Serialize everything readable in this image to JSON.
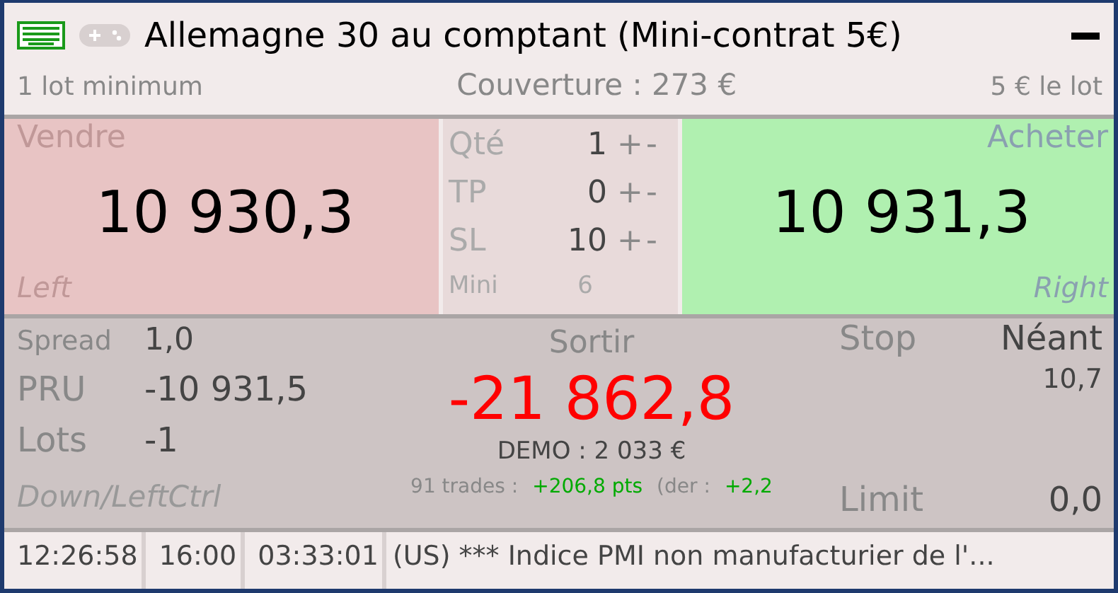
{
  "window": {
    "title": "Allemagne 30 au comptant (Mini-contrat 5€)"
  },
  "info_bar": {
    "minimum": "1 lot minimum",
    "coverage": "Couverture : 273 €",
    "lot_value": "5 € le lot"
  },
  "sell": {
    "label": "Vendre",
    "price": "10 930,3",
    "shortcut": "Left"
  },
  "order_params": [
    {
      "kind": "stepper",
      "label": "Qté",
      "value": "1",
      "plus": "+",
      "minus": "-"
    },
    {
      "kind": "stepper",
      "label": "TP",
      "value": "0",
      "plus": "+",
      "minus": "-"
    },
    {
      "kind": "stepper",
      "label": "SL",
      "value": "10",
      "plus": "+",
      "minus": "-"
    },
    {
      "kind": "info",
      "label": "Mini",
      "value": "6"
    }
  ],
  "buy": {
    "label": "Acheter",
    "price": "10 931,3",
    "shortcut": "Right"
  },
  "position": {
    "stats": [
      {
        "label": "Spread",
        "value": "1,0"
      },
      {
        "label": "PRU",
        "value": "-10 931,5"
      },
      {
        "label": "Lots",
        "value": "-1"
      }
    ],
    "shortcut": "Down/LeftCtrl",
    "exit_label": "Sortir",
    "result": "-21 862,8",
    "account": "DEMO : 2 033 €",
    "trades": "91 trades :",
    "total_pts": "+206,8 pts",
    "last_label": "(der :",
    "last_value": "+2,2",
    "stop_label": "Stop",
    "stop_value": "Néant",
    "stop_distance": "10,7",
    "limit_label": "Limit",
    "limit_value": "0,0"
  },
  "status_bar": [
    "12:26:58",
    "16:00",
    "03:33:01",
    "(US) *** Indice PMI non manufacturier de l'..."
  ]
}
